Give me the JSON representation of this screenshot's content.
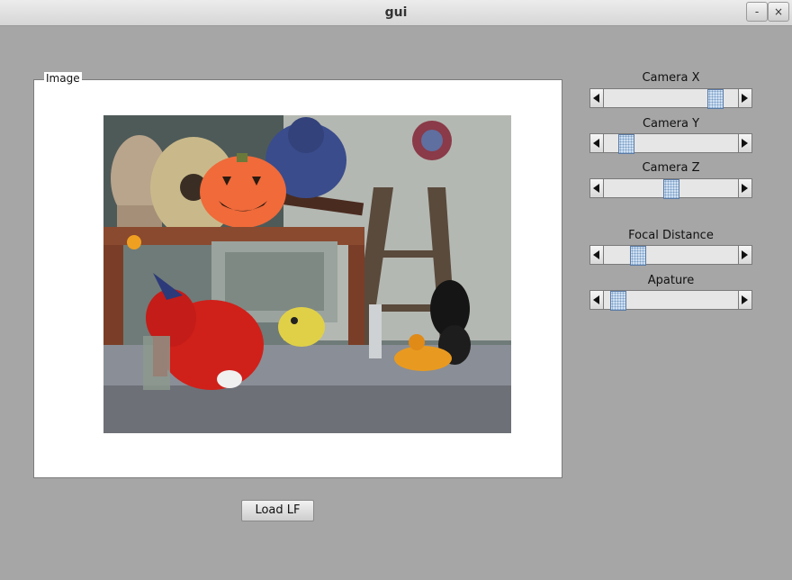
{
  "window": {
    "title": "gui",
    "minimize_label": "-",
    "close_label": "×"
  },
  "image_panel": {
    "label": "Image"
  },
  "load_button": {
    "label": "Load LF"
  },
  "sliders": [
    {
      "label": "Camera X",
      "value": 0.88
    },
    {
      "label": "Camera Y",
      "value": 0.12
    },
    {
      "label": "Camera Z",
      "value": 0.5
    },
    {
      "label": "Focal Distance",
      "value": 0.22
    },
    {
      "label": "Apature",
      "value": 0.05
    }
  ],
  "colors": {
    "background": "#a6a6a6",
    "panel": "#ffffff",
    "thumb": "#cfe0f2"
  }
}
